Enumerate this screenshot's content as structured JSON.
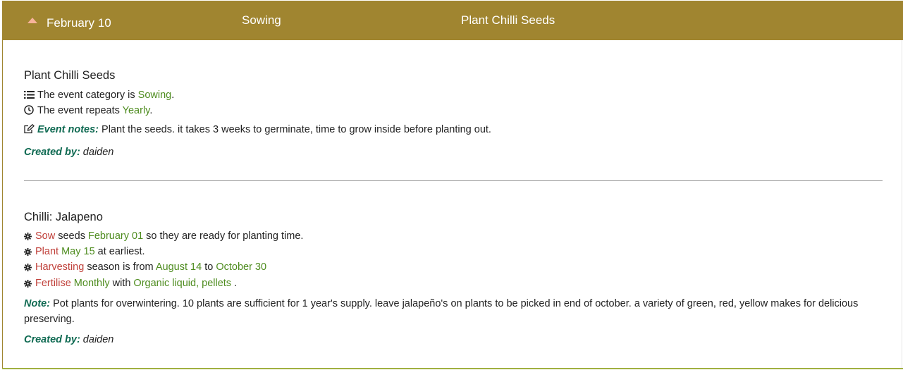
{
  "header": {
    "date": "February 10",
    "category": "Sowing",
    "title": "Plant Chilli Seeds"
  },
  "event": {
    "title": "Plant Chilli Seeds",
    "category_prefix": "The event category is ",
    "category_value": "Sowing",
    "category_suffix": ".",
    "repeat_prefix": "The event repeats ",
    "repeat_value": "Yearly",
    "repeat_suffix": ".",
    "notes_label": "Event notes:",
    "notes_text": " Plant the seeds. it takes 3 weeks to germinate, time to grow inside before planting out.",
    "created_label": "Created by:",
    "created_value": " daiden"
  },
  "plant": {
    "title": "Chilli: Jalapeno",
    "sow": {
      "label": "Sow",
      "mid": " seeds ",
      "date": "February 01",
      "rest": " so they are ready for planting time."
    },
    "plant": {
      "label": "Plant",
      "date": "May 15",
      "rest": " at earliest."
    },
    "harvest": {
      "label": "Harvesting",
      "mid": " season is from ",
      "from": "August 14",
      "to_word": " to ",
      "to": "October 30"
    },
    "fertilise": {
      "label": "Fertilise",
      "freq": "Monthly",
      "mid": " with ",
      "what": "Organic liquid, pellets",
      "end": " ."
    },
    "note_label": "Note:",
    "note_text": " Pot plants for overwintering. 10 plants are sufficient for 1 year's supply. leave jalapeño's on plants to be picked in end of october. a variety of green, red, yellow makes for delicious preserving.",
    "created_label": "Created by:",
    "created_value": " daiden"
  },
  "icons": [
    "list-icon",
    "clock-icon",
    "edit-icon",
    "gear-icon"
  ],
  "colors": {
    "header": "#a08530",
    "green": "#4e8c1f",
    "red": "#c0403a",
    "teal": "#0f6a52"
  }
}
